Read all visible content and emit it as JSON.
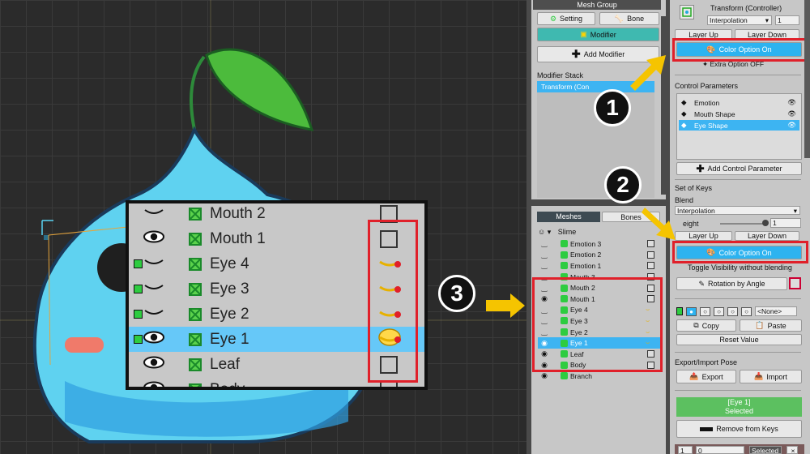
{
  "zoom_list": [
    {
      "label": "Mouth 2",
      "eye": "closed",
      "green_square": false,
      "state": "checkbox",
      "selected": false
    },
    {
      "label": "Mouth 1",
      "eye": "open",
      "green_square": false,
      "state": "checkbox",
      "selected": false
    },
    {
      "label": "Eye 4",
      "eye": "closed",
      "green_square": true,
      "state": "key",
      "selected": false
    },
    {
      "label": "Eye 3",
      "eye": "closed",
      "green_square": true,
      "state": "key",
      "selected": false
    },
    {
      "label": "Eye 2",
      "eye": "closed",
      "green_square": true,
      "state": "key",
      "selected": false
    },
    {
      "label": "Eye 1",
      "eye": "open",
      "green_square": true,
      "state": "key-active",
      "selected": true
    },
    {
      "label": "Leaf",
      "eye": "open",
      "green_square": false,
      "state": "checkbox",
      "selected": false
    },
    {
      "label": "Body",
      "eye": "open",
      "green_square": false,
      "state": "checkbox",
      "selected": false
    }
  ],
  "mid": {
    "mesh_group_header": "Mesh Group",
    "setting_label": "Setting",
    "bone_label": "Bone",
    "modifier_label": "Modifier",
    "add_modifier_label": "Add Modifier",
    "modifier_stack_label": "Modifier Stack",
    "modifier_stack_item": "Transform (Con",
    "tabs": [
      "Meshes",
      "Bones"
    ],
    "root_label": "Slime",
    "rows": [
      {
        "name": "Emotion 3",
        "eye": "‿",
        "state": "checkbox"
      },
      {
        "name": "Emotion 2",
        "eye": "‿",
        "state": "checkbox"
      },
      {
        "name": "Emotion 1",
        "eye": "‿",
        "state": "checkbox"
      },
      {
        "name": "Mouth 3",
        "eye": "‿",
        "state": "checkbox"
      },
      {
        "name": "Mouth 2",
        "eye": "‿",
        "state": "checkbox"
      },
      {
        "name": "Mouth 1",
        "eye": "◉",
        "state": "checkbox"
      },
      {
        "name": "Eye 4",
        "eye": "‿",
        "state": "key"
      },
      {
        "name": "Eye 3",
        "eye": "‿",
        "state": "key"
      },
      {
        "name": "Eye 2",
        "eye": "‿",
        "state": "key"
      },
      {
        "name": "Eye 1",
        "eye": "◉",
        "state": "key",
        "selected": true
      },
      {
        "name": "Leaf",
        "eye": "◉",
        "state": "checkbox"
      },
      {
        "name": "Body",
        "eye": "◉",
        "state": "checkbox"
      },
      {
        "name": "Branch",
        "eye": "◉",
        "state": "none"
      }
    ]
  },
  "right": {
    "title": "Transform (Controller)",
    "interpolation": "Interpolation",
    "interp_value": "1",
    "layer_up": "Layer Up",
    "layer_down": "Layer Down",
    "color_option": "Color Option On",
    "extra_option": "Extra Option OFF",
    "control_params_label": "Control Parameters",
    "params": [
      {
        "name": "Emotion",
        "selected": false
      },
      {
        "name": "Mouth Shape",
        "selected": false
      },
      {
        "name": "Eye Shape",
        "selected": true
      }
    ],
    "add_param": "Add Control Parameter",
    "set_of_keys": "Set of Keys",
    "blend": "Blend",
    "blend_value": "Interpolation",
    "weight_label": "eight",
    "weight_value": "1",
    "layer_up2": "Layer Up",
    "layer_down2": "Layer Down",
    "color_option2": "Color Option On",
    "toggle_vis": "Toggle Visibility without blending",
    "rotation_by_angle": "Rotation by Angle",
    "none_option": "<None>",
    "copy": "Copy",
    "paste": "Paste",
    "reset_value": "Reset Value",
    "export_import_label": "Export/Import Pose",
    "export": "Export",
    "import": "Import",
    "selected_line1": "[Eye 1]",
    "selected_line2": "Selected",
    "remove_from_keys": "Remove from Keys",
    "bottom_val1": "1",
    "bottom_val2": "0",
    "bottom_selected": "Selected",
    "bottom_x": "×"
  },
  "badges": [
    "1",
    "2",
    "3"
  ],
  "colors": {
    "accent_blue": "#2db3f0",
    "teal": "#3fb9b0",
    "highlight_red": "#e0202a",
    "arrow_yellow": "#f5c400",
    "selected_green": "#5cc060"
  }
}
